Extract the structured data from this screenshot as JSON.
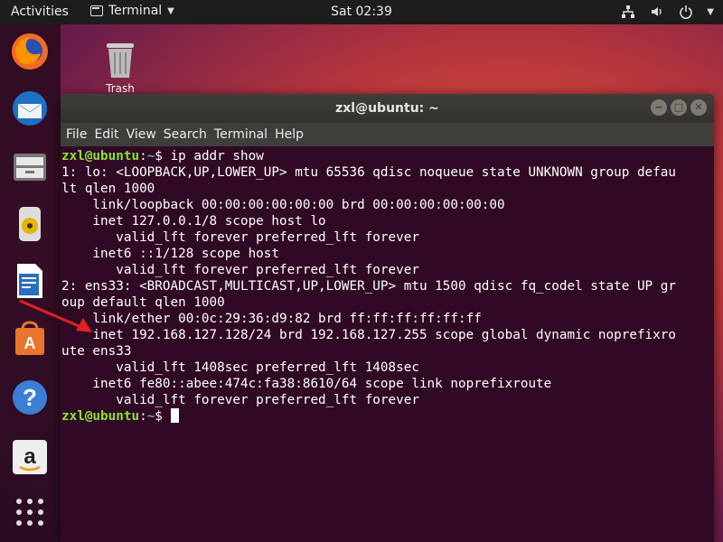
{
  "topbar": {
    "activities": "Activities",
    "app_name": "Terminal",
    "clock": "Sat 02:39"
  },
  "desktop": {
    "trash_label": "Trash"
  },
  "window": {
    "title": "zxl@ubuntu: ~",
    "menu": [
      "File",
      "Edit",
      "View",
      "Search",
      "Terminal",
      "Help"
    ]
  },
  "terminal": {
    "prompt_user": "zxl@ubuntu",
    "prompt_sep": ":",
    "prompt_path": "~",
    "prompt_dollar": "$",
    "command": " ip addr show",
    "output": [
      "1: lo: <LOOPBACK,UP,LOWER_UP> mtu 65536 qdisc noqueue state UNKNOWN group defau",
      "lt qlen 1000",
      "    link/loopback 00:00:00:00:00:00 brd 00:00:00:00:00:00",
      "    inet 127.0.0.1/8 scope host lo",
      "       valid_lft forever preferred_lft forever",
      "    inet6 ::1/128 scope host",
      "       valid_lft forever preferred_lft forever",
      "2: ens33: <BROADCAST,MULTICAST,UP,LOWER_UP> mtu 1500 qdisc fq_codel state UP gr",
      "oup default qlen 1000",
      "    link/ether 00:0c:29:36:d9:82 brd ff:ff:ff:ff:ff:ff",
      "    inet 192.168.127.128/24 brd 192.168.127.255 scope global dynamic noprefixro",
      "ute ens33",
      "       valid_lft 1408sec preferred_lft 1408sec",
      "    inet6 fe80::abee:474c:fa38:8610/64 scope link noprefixroute",
      "       valid_lft forever preferred_lft forever"
    ]
  },
  "dock": {
    "items": [
      "firefox-icon",
      "thunderbird-icon",
      "files-icon",
      "rhythmbox-icon",
      "libreoffice-writer-icon",
      "software-center-icon",
      "help-icon",
      "amazon-icon",
      "show-apps-icon"
    ]
  },
  "colors": {
    "terminal_bg": "#300a24",
    "prompt_user": "#8ae234",
    "prompt_path": "#729fcf",
    "arrow": "#e02020"
  }
}
